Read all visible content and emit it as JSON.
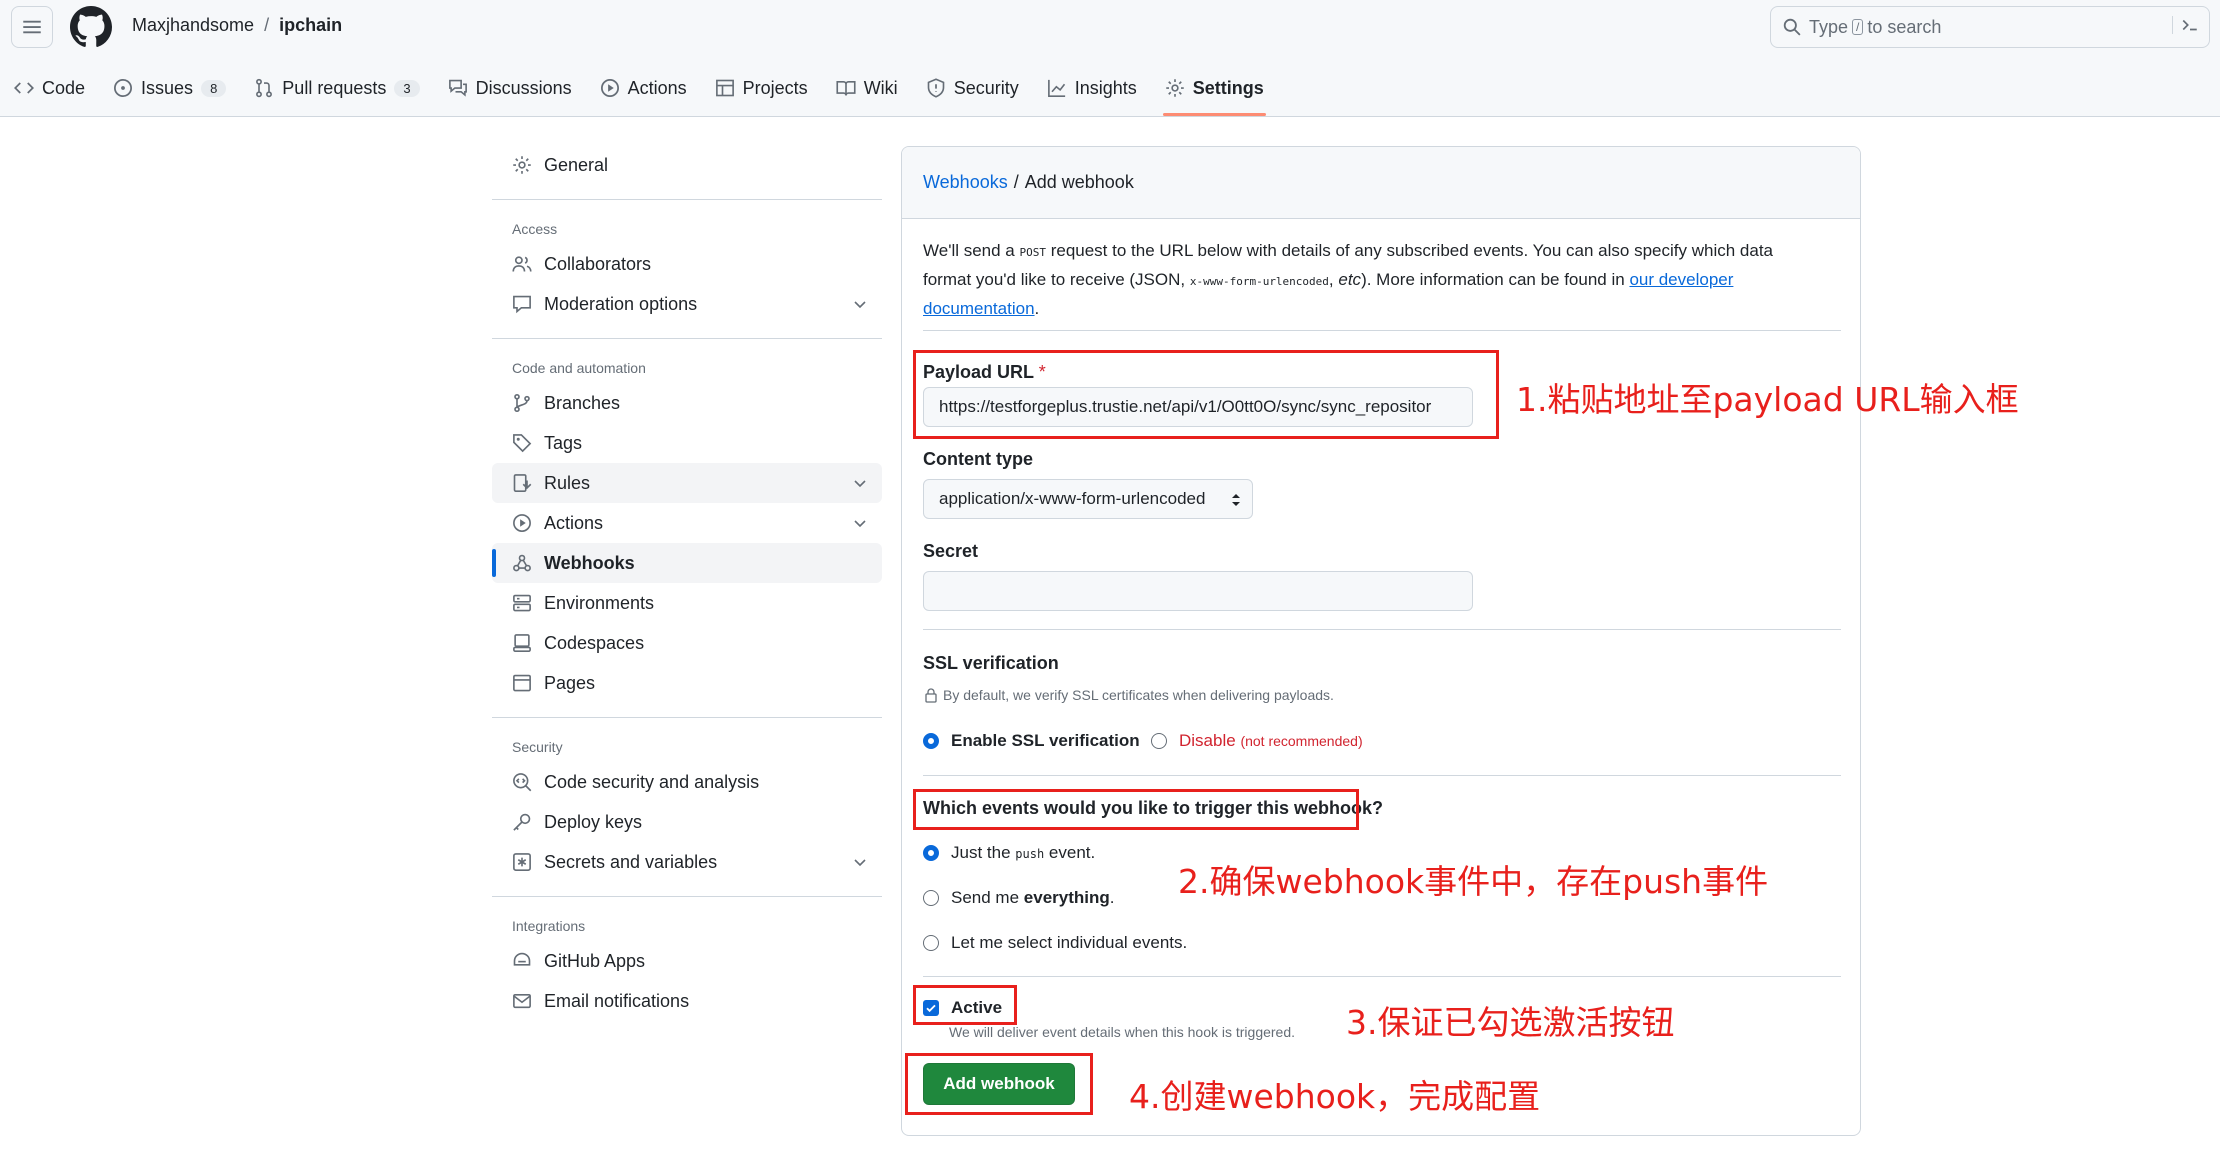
{
  "header": {
    "owner": "Maxjhandsome",
    "separator": "/",
    "repo": "ipchain",
    "search": {
      "prefix": "Type",
      "key": "/",
      "suffix": "to search",
      "terminal_icon": "command-palette-icon"
    }
  },
  "tabs": [
    {
      "label": "Code",
      "icon": "code-icon"
    },
    {
      "label": "Issues",
      "icon": "issue-icon",
      "count": "8"
    },
    {
      "label": "Pull requests",
      "icon": "pull-request-icon",
      "count": "3"
    },
    {
      "label": "Discussions",
      "icon": "discussion-icon"
    },
    {
      "label": "Actions",
      "icon": "play-icon"
    },
    {
      "label": "Projects",
      "icon": "table-icon"
    },
    {
      "label": "Wiki",
      "icon": "book-icon"
    },
    {
      "label": "Security",
      "icon": "shield-icon"
    },
    {
      "label": "Insights",
      "icon": "graph-icon"
    },
    {
      "label": "Settings",
      "icon": "gear-icon",
      "active": true
    }
  ],
  "sidebar": {
    "general": "General",
    "access": {
      "heading": "Access",
      "items": [
        "Collaborators",
        "Moderation options"
      ]
    },
    "code_automation": {
      "heading": "Code and automation",
      "items": [
        "Branches",
        "Tags",
        "Rules",
        "Actions",
        "Webhooks",
        "Environments",
        "Codespaces",
        "Pages"
      ]
    },
    "security": {
      "heading": "Security",
      "items": [
        "Code security and analysis",
        "Deploy keys",
        "Secrets and variables"
      ]
    },
    "integrations": {
      "heading": "Integrations",
      "items": [
        "GitHub Apps",
        "Email notifications"
      ]
    }
  },
  "panel": {
    "breadcrumb_link": "Webhooks",
    "breadcrumb_sep": "/",
    "breadcrumb_current": "Add webhook",
    "intro": {
      "p1": "We'll send a ",
      "post": "POST",
      "p2": " request to the URL below with details of any subscribed events. You can also specify which data format you'd like to receive (JSON, ",
      "form": "x-www-form-urlencoded",
      "p3": ", ",
      "etc": "etc",
      "p4": "). More information can be found in ",
      "link": "our developer documentation",
      "p5": "."
    },
    "payload": {
      "label": "Payload URL",
      "required": "*",
      "value": "https://testforgeplus.trustie.net/api/v1/O0tt0O/sync/sync_repositor"
    },
    "content_type": {
      "label": "Content type",
      "value": "application/x-www-form-urlencoded"
    },
    "secret": {
      "label": "Secret",
      "value": ""
    },
    "ssl": {
      "label": "SSL verification",
      "note": "By default, we verify SSL certificates when delivering payloads.",
      "enable": "Enable SSL verification",
      "disable": "Disable",
      "disable_note": "(not recommended)"
    },
    "events": {
      "question": "Which events would you like to trigger this webhook?",
      "opt1_pre": "Just the",
      "opt1_code": "push",
      "opt1_post": "event.",
      "opt2_pre": "Send me",
      "opt2_bold": "everything",
      "opt2_post": ".",
      "opt3": "Let me select individual events."
    },
    "active": {
      "label": "Active",
      "checked": true,
      "note": "We will deliver event details when this hook is triggered."
    },
    "submit": "Add webhook"
  },
  "annotations": {
    "a1": "1.粘贴地址至payload URL输入框",
    "a2": "2.确保webhook事件中，存在push事件",
    "a3": "3.保证已勾选激活按钮",
    "a4": "4.创建webhook，完成配置",
    "color": "#e8201c"
  },
  "colors": {
    "accent": "#0969da",
    "green": "#1f883d",
    "tab_underline": "#fd8c73",
    "danger": "#d1242f"
  }
}
